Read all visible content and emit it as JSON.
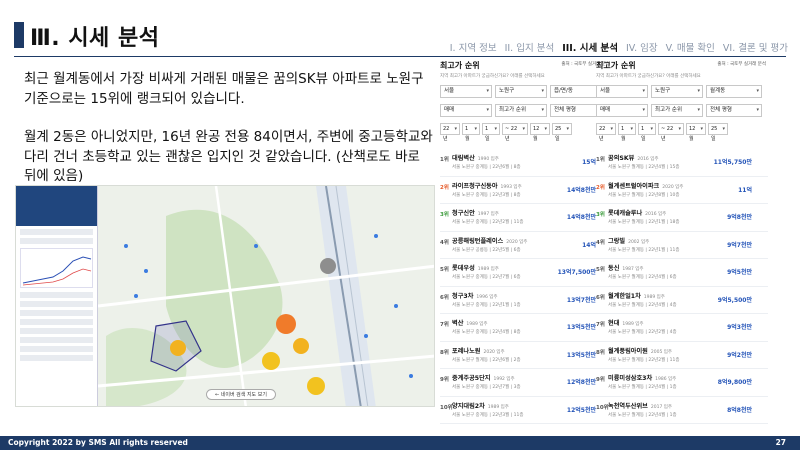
{
  "header": {
    "title": "Ⅲ. 시세 분석",
    "nav": [
      "I. 지역 정보",
      "II. 입지 분석",
      "III. 시세 분석",
      "IV. 임장",
      "V. 매물 확인",
      "VI. 결론 및 평가"
    ],
    "active_index": 2
  },
  "body": {
    "paragraph1": "최근 월계동에서 가장 비싸게 거래된 매물은 꿈의SK뷰 아파트로 노원구 기준으로는 15위에 랭크되어 있습니다.",
    "paragraph2": "월계 2동은 아니었지만, 16년 완공 전용 84이면서, 주변에 중고등학교와 다리 건너 초등학교 있는 괜찮은 입지인 것 같았습니다. (산책로도 바로 뒤에 있음)"
  },
  "map": {
    "footer": "← 네이버 검색 지도 보기"
  },
  "panel_left": {
    "title": "최고가 순위",
    "source": "출처 : 국토부 실거래 분석",
    "subtitle": "지역 최고가 아파트가 궁금하신가요? 아래를 선택하세요",
    "filters1": [
      "서울",
      "노원구",
      "읍/면/동"
    ],
    "filters2": [
      "매매",
      "최고가 순위",
      "전체 평형"
    ],
    "period": [
      "22년",
      "1월",
      "1일",
      "~ 22년",
      "12월",
      "25일"
    ],
    "items": [
      {
        "rank": "1위",
        "name": "대림벽산",
        "year": "1990 입주",
        "meta": "서울 노원구 중계동 | 22년6월 | 8층",
        "price": "15억",
        "style": ""
      },
      {
        "rank": "2위",
        "name": "라이프청구신동아",
        "year": "1993 입주",
        "meta": "서울 노원구 중계동 | 22년3월 | 8층",
        "price": "14억8천만",
        "style": "hot"
      },
      {
        "rank": "3위",
        "name": "청구신안",
        "year": "1997 입주",
        "meta": "서울 노원구 중계동 | 22년2월 | 11층",
        "price": "14억8천만",
        "style": "new"
      },
      {
        "rank": "4위",
        "name": "공릉해링턴플레이스",
        "year": "2020 입주",
        "meta": "서울 노원구 공릉동 | 22년5월 | 6층",
        "price": "14억",
        "style": ""
      },
      {
        "rank": "5위",
        "name": "롯데우성",
        "year": "1989 입주",
        "meta": "서울 노원구 중계동 | 22년7월 | 6층",
        "price": "13억7,500만",
        "style": ""
      },
      {
        "rank": "6위",
        "name": "청구3차",
        "year": "1996 입주",
        "meta": "서울 노원구 중계동 | 22년1월 | 1층",
        "price": "13억7천만",
        "style": ""
      },
      {
        "rank": "7위",
        "name": "벽산",
        "year": "1989 입주",
        "meta": "서울 노원구 중계동 | 22년4월 | 8층",
        "price": "13억5천만",
        "style": ""
      },
      {
        "rank": "8위",
        "name": "포레나노원",
        "year": "2020 입주",
        "meta": "서울 노원구 월계동 | 22년6월 | 2층",
        "price": "13억5천만",
        "style": ""
      },
      {
        "rank": "9위",
        "name": "중계주공5단지",
        "year": "1992 입주",
        "meta": "서울 노원구 중계동 | 22년7월 | 3층",
        "price": "12억8천만",
        "style": ""
      },
      {
        "rank": "10위",
        "name": "양지대림2차",
        "year": "1989 입주",
        "meta": "서울 노원구 중계동 | 22년3월 | 11층",
        "price": "12억5천만",
        "style": ""
      }
    ]
  },
  "panel_right": {
    "title": "최고가 순위",
    "source": "출처 : 국토부 실거래 분석",
    "subtitle": "지역 최고가 아파트가 궁금하신가요? 아래를 선택하세요",
    "filters1": [
      "서울",
      "노원구",
      "월계동"
    ],
    "filters2": [
      "매매",
      "최고가 순위",
      "전체 평형"
    ],
    "period": [
      "22년",
      "1월",
      "1일",
      "~ 22년",
      "12월",
      "25일"
    ],
    "items": [
      {
        "rank": "1위",
        "name": "꿈의SK뷰",
        "year": "2016 입주",
        "meta": "서울 노원구 월계동 | 22년4월 | 15층",
        "price": "11억5,750만",
        "style": ""
      },
      {
        "rank": "2위",
        "name": "월계센트럴아이파크",
        "year": "2020 입주",
        "meta": "서울 노원구 월계동 | 22년8월 | 10층",
        "price": "11억",
        "style": "hot"
      },
      {
        "rank": "3위",
        "name": "롯데캐슬루나",
        "year": "2016 입주",
        "meta": "서울 노원구 월계동 | 22년1월 | 18층",
        "price": "9억8천만",
        "style": "new"
      },
      {
        "rank": "4위",
        "name": "그랑빌",
        "year": "2002 입주",
        "meta": "서울 노원구 월계동 | 22년1월 | 11층",
        "price": "9억7천만",
        "style": ""
      },
      {
        "rank": "5위",
        "name": "동신",
        "year": "1987 입주",
        "meta": "서울 노원구 월계동 | 22년4월 | 6층",
        "price": "9억5천만",
        "style": ""
      },
      {
        "rank": "6위",
        "name": "월계한일1차",
        "year": "1989 입주",
        "meta": "서울 노원구 월계동 | 22년4월 | 4층",
        "price": "9억5,500만",
        "style": ""
      },
      {
        "rank": "7위",
        "name": "현대",
        "year": "1989 입주",
        "meta": "서울 노원구 월계동 | 22년2월 | 4층",
        "price": "9억3천만",
        "style": ""
      },
      {
        "rank": "8위",
        "name": "월계풍림아이원",
        "year": "2005 입주",
        "meta": "서울 노원구 월계동 | 22년2월 | 11층",
        "price": "9억2천만",
        "style": ""
      },
      {
        "rank": "9위",
        "name": "미륭미성삼호3차",
        "year": "1986 입주",
        "meta": "서울 노원구 월계동 | 22년4월 | 1층",
        "price": "8억9,800만",
        "style": ""
      },
      {
        "rank": "10위",
        "name": "녹천역두산위브",
        "year": "2017 입주",
        "meta": "서울 노원구 월계동 | 22년4월 | 1층",
        "price": "8억8천만",
        "style": ""
      }
    ]
  },
  "footer": {
    "copyright": "Copyright 2022 by SMS All rights reserved",
    "page": "27"
  }
}
